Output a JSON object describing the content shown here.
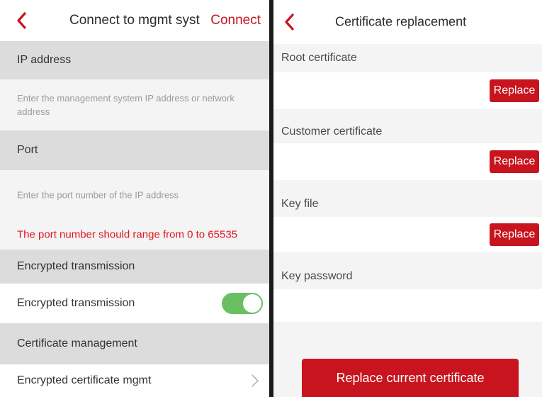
{
  "left": {
    "header": {
      "back_icon": "chevron-left-icon",
      "title": "Connect to mgmt syst",
      "action": "Connect"
    },
    "ip_section": {
      "label": "IP address",
      "placeholder": "Enter the management system IP address or network address"
    },
    "port_section": {
      "label": "Port",
      "placeholder": "Enter the port number of the IP address",
      "error": "The port number should range from 0 to 65535"
    },
    "encryption_section": {
      "label": "Encrypted transmission",
      "toggle_label": "Encrypted transmission",
      "toggle_on": true
    },
    "certificate_section": {
      "label": "Certificate management",
      "item_label": "Encrypted certificate mgmt",
      "item_icon": "chevron-right-icon"
    }
  },
  "right": {
    "header": {
      "back_icon": "chevron-left-icon",
      "title": "Certificate replacement"
    },
    "root_certificate": {
      "label": "Root certificate",
      "button": "Replace"
    },
    "customer_certificate": {
      "label": "Customer certificate",
      "button": "Replace"
    },
    "key_file": {
      "label": "Key file",
      "button": "Replace"
    },
    "key_password": {
      "label": "Key password"
    },
    "main_button": "Replace current certificate"
  },
  "colors": {
    "accent": "#c8141e",
    "error": "#e0141e",
    "toggle": "#6abf63",
    "section_bg": "#dcdcdc",
    "divider": "#1a1a1a"
  }
}
